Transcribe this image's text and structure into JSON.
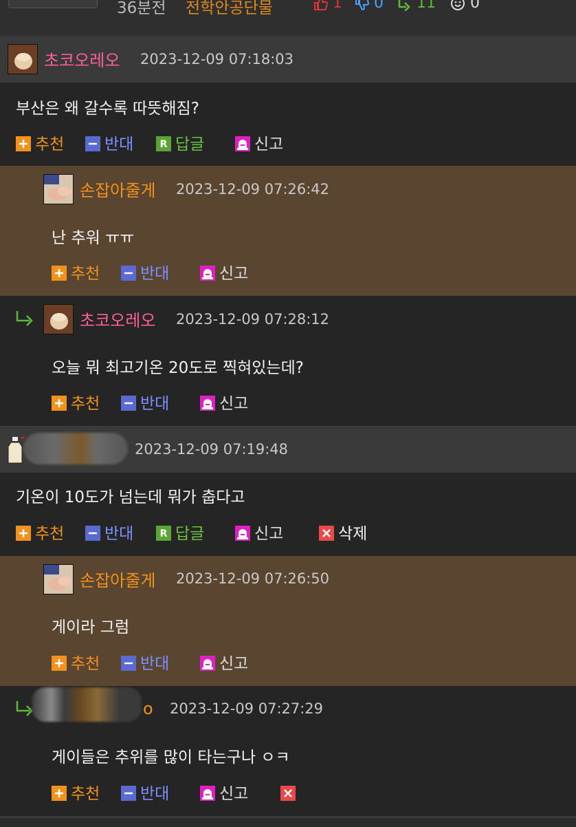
{
  "topbar": {
    "time": "36분전",
    "category": "전학안공단물",
    "upvotes": "1",
    "downvotes": "0",
    "replies": "11",
    "emotes": "0"
  },
  "actions": {
    "recommend": "추천",
    "oppose": "반대",
    "reply": "답글",
    "report": "신고",
    "delete": "삭제"
  },
  "comments": [
    {
      "nick": "초코오레오",
      "date": "2023-12-09 07:18:03",
      "text": "부산은 왜 갈수록 따뜻해짐?"
    },
    {
      "nick": "손잡아줄게",
      "date": "2023-12-09 07:26:42",
      "text": "난 추워 ㅠㅠ"
    },
    {
      "nick": "초코오레오",
      "date": "2023-12-09 07:28:12",
      "text": "오늘 뭐 최고기온 20도로 찍혀있는데?"
    },
    {
      "nick": "",
      "date": "2023-12-09 07:19:48",
      "text": "기온이 10도가 넘는데 뭐가 춥다고"
    },
    {
      "nick": "손잡아줄게",
      "date": "2023-12-09 07:26:50",
      "text": "게이라 그럼"
    },
    {
      "nick": "o",
      "date": "2023-12-09 07:27:29",
      "text": "게이들은 추위를 많이 타는구나 ㅇㅋ"
    }
  ],
  "colors": {
    "recommend": "#f0921c",
    "oppose": "#5a6ad0",
    "reply": "#5aa534",
    "report": "#e01fc4",
    "delete": "#e84a4a",
    "nick_pink": "#ff5e9c",
    "nick_orange": "#f0921c"
  }
}
